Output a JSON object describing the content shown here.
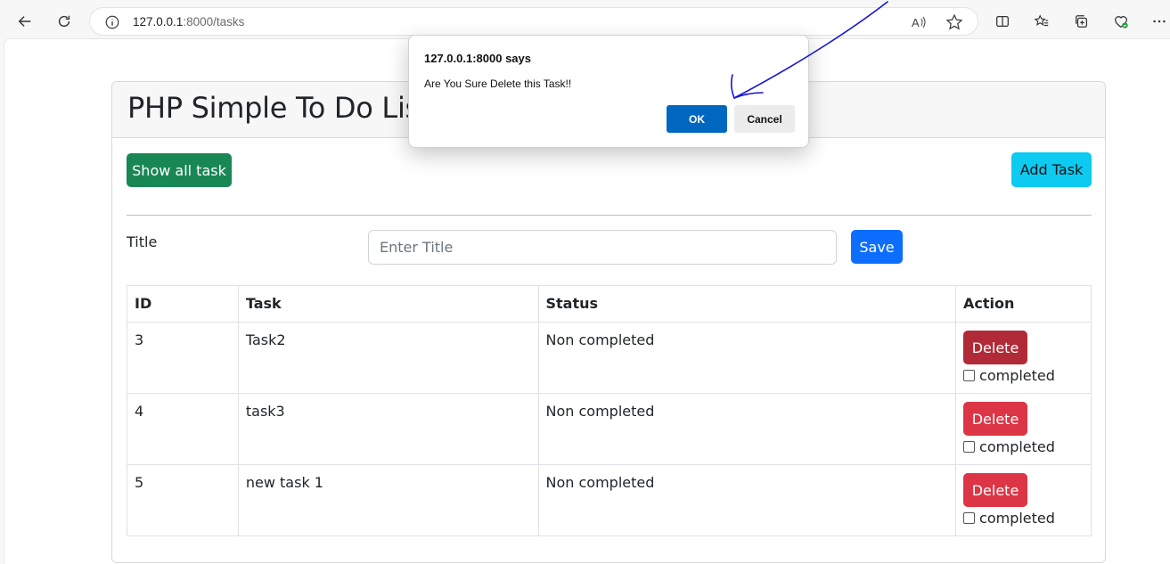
{
  "browser": {
    "url_host": "127.0.0.1",
    "url_path": ":8000/tasks"
  },
  "page": {
    "title": "PHP Simple To Do List",
    "show_all_label": "Show all task",
    "add_task_label": "Add Task",
    "title_label": "Title",
    "title_placeholder": "Enter Title",
    "save_label": "Save"
  },
  "table": {
    "headers": [
      "ID",
      "Task",
      "Status",
      "Action"
    ],
    "rows": [
      {
        "id": "3",
        "task": "Task2",
        "status": "Non completed",
        "delete_label": "Delete",
        "completed_label": "completed"
      },
      {
        "id": "4",
        "task": "task3",
        "status": "Non completed",
        "delete_label": "Delete",
        "completed_label": "completed"
      },
      {
        "id": "5",
        "task": "new task 1",
        "status": "Non completed",
        "delete_label": "Delete",
        "completed_label": "completed"
      }
    ]
  },
  "dialog": {
    "title": "127.0.0.1:8000 says",
    "message": "Are You Sure Delete this Task!!",
    "ok_label": "OK",
    "cancel_label": "Cancel"
  },
  "colors": {
    "success": "#198754",
    "info": "#0dcaf0",
    "primary": "#0d6efd",
    "danger": "#dc3545",
    "dialog_ok": "#0067c0",
    "annotation": "#1515d6"
  }
}
